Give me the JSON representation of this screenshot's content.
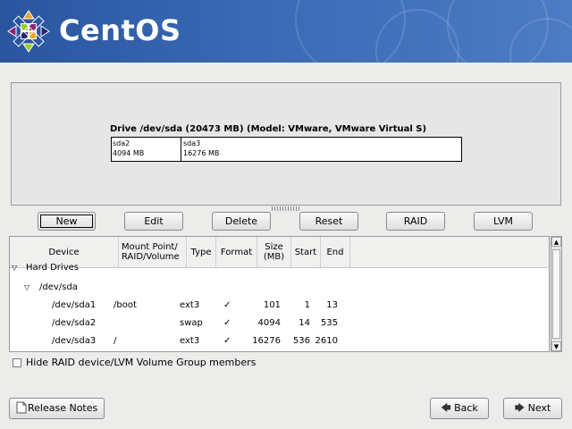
{
  "brand": {
    "name": "CentOS"
  },
  "drive": {
    "title": "Drive /dev/sda (20473 MB) (Model: VMware, VMware Virtual S)",
    "segments": [
      {
        "name": "sda2",
        "size": "4094 MB"
      },
      {
        "name": "sda3",
        "size": "16276 MB"
      }
    ]
  },
  "toolbar": {
    "new": "New",
    "edit": "Edit",
    "delete": "Delete",
    "reset": "Reset",
    "raid": "RAID",
    "lvm": "LVM"
  },
  "table": {
    "headers": {
      "device": "Device",
      "mount": "Mount Point/\nRAID/Volume",
      "type": "Type",
      "format": "Format",
      "size": "Size\n(MB)",
      "start": "Start",
      "end": "End"
    },
    "group_label": "Hard Drives",
    "disk_label": "/dev/sda",
    "rows": [
      {
        "device": "/dev/sda1",
        "mount": "/boot",
        "type": "ext3",
        "format": "✓",
        "size": "101",
        "start": "1",
        "end": "13"
      },
      {
        "device": "/dev/sda2",
        "mount": "",
        "type": "swap",
        "format": "✓",
        "size": "4094",
        "start": "14",
        "end": "535"
      },
      {
        "device": "/dev/sda3",
        "mount": "/",
        "type": "ext3",
        "format": "✓",
        "size": "16276",
        "start": "536",
        "end": "2610"
      }
    ]
  },
  "options": {
    "hide_raid_label": "Hide RAID device/LVM Volume Group members"
  },
  "footer": {
    "release_notes": "Release Notes",
    "back": "Back",
    "next": "Next"
  },
  "colors": {
    "banner": "#2a55a0",
    "background": "#ececeb"
  }
}
